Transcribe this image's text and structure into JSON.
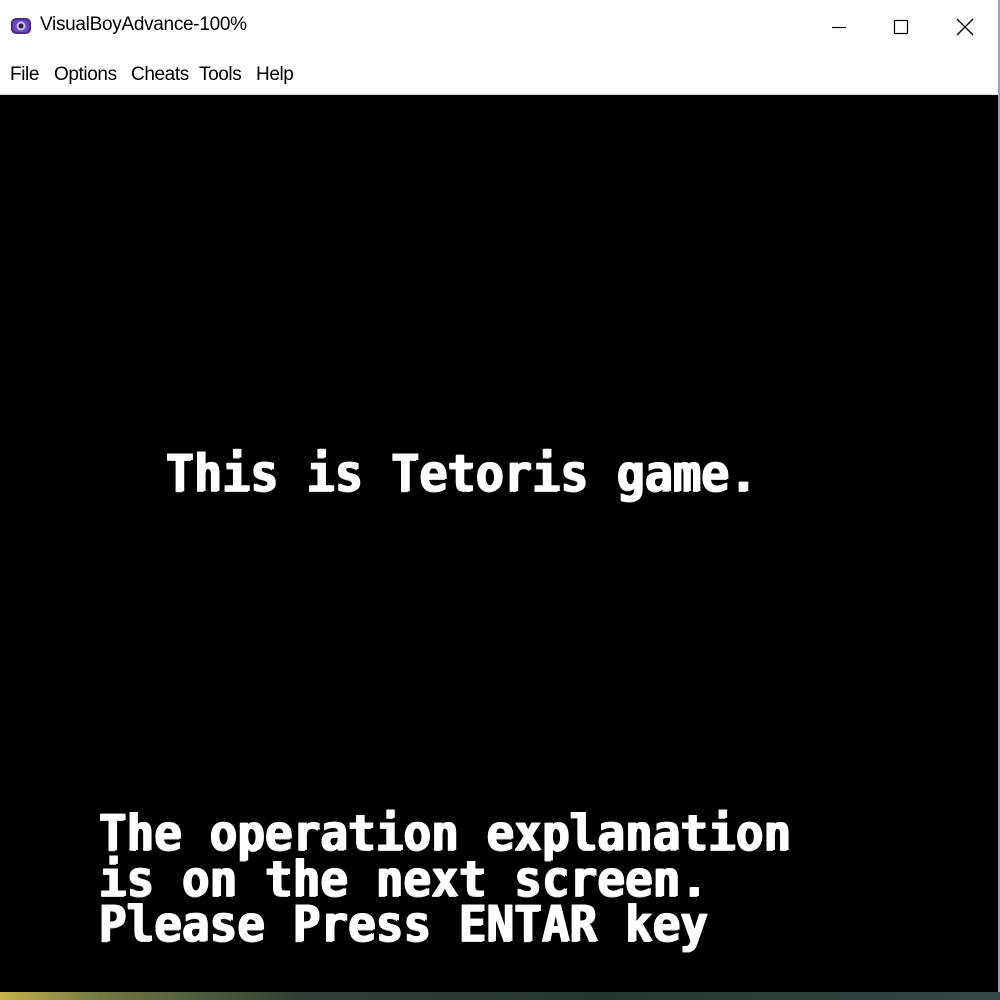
{
  "window": {
    "title": "VisualBoyAdvance-100%",
    "icon": "visualboyadvance-icon",
    "controls": {
      "minimize_icon": "minimize-icon",
      "maximize_icon": "maximize-icon",
      "close_icon": "close-icon"
    }
  },
  "menubar": {
    "items": [
      {
        "label": "File"
      },
      {
        "label": "Options"
      },
      {
        "label": "Cheats"
      },
      {
        "label": "Tools"
      },
      {
        "label": "Help"
      }
    ]
  },
  "game_screen": {
    "headline": "This is Tetoris game.",
    "instructions": [
      "The operation explanation",
      "is on the next screen.",
      "Please Press ENTAR key"
    ]
  },
  "colors": {
    "screen_background": "#000000",
    "text": "#ffffff",
    "titlebar": "#ffffff"
  }
}
